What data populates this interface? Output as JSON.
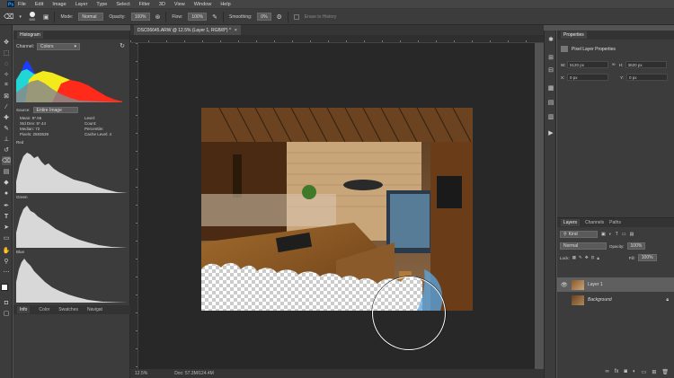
{
  "menu": [
    "File",
    "Edit",
    "Image",
    "Layer",
    "Type",
    "Select",
    "Filter",
    "3D",
    "View",
    "Window",
    "Help"
  ],
  "options": {
    "brush_size": "600",
    "mode_label": "Mode:",
    "mode_value": "Normal",
    "opacity_label": "Opacity:",
    "opacity_value": "100%",
    "flow_label": "Flow:",
    "flow_value": "100%",
    "smoothing_label": "Smoothing:",
    "smoothing_value": "0%",
    "erase_history": "Erase to History"
  },
  "document": {
    "tab_title": "DSC06645.ARW @ 12.5% (Layer 1, RGB/8*) *",
    "close": "×"
  },
  "status": {
    "zoom": "12.5%",
    "doc": "Doc: 57.3M/124.4M"
  },
  "histogram": {
    "tab": "Histogram",
    "channel_label": "Channel:",
    "channel_value": "Colors",
    "source_label": "Source:",
    "source_value": "Entire Image",
    "stats": {
      "mean": "Mean: 8*.66",
      "stddev": "Std Dev: 5*.44",
      "median": "Median: 72",
      "pixels": "Pixels: 2593539",
      "level": "Level:",
      "count": "Count:",
      "percentile": "Percentile:",
      "cache": "Cache Level: 4"
    },
    "red_label": "Red",
    "green_label": "Green",
    "blue_label": "Blue",
    "bottom_tabs": [
      "Info",
      "Color",
      "Swatches",
      "Navigat"
    ]
  },
  "properties": {
    "tab": "Properties",
    "title": "Pixel Layer Properties",
    "w_label": "W:",
    "w_value": "5120 px",
    "h_label": "H:",
    "h_value": "3620 px",
    "x_label": "X:",
    "x_value": "0 px",
    "y_label": "Y:",
    "y_value": "0 px"
  },
  "layers": {
    "tabs": [
      "Layers",
      "Channels",
      "Paths"
    ],
    "kind": "Kind",
    "blend": "Normal",
    "opacity_label": "Opacity:",
    "opacity_value": "100%",
    "lock_label": "Lock:",
    "fill_label": "Fill:",
    "fill_value": "100%",
    "items": [
      {
        "name": "Layer 1"
      },
      {
        "name": "Background"
      }
    ]
  },
  "colors": {
    "accent": "#1473e6",
    "canvas_bg": "#282828",
    "panel_bg": "#3c3c3c"
  }
}
